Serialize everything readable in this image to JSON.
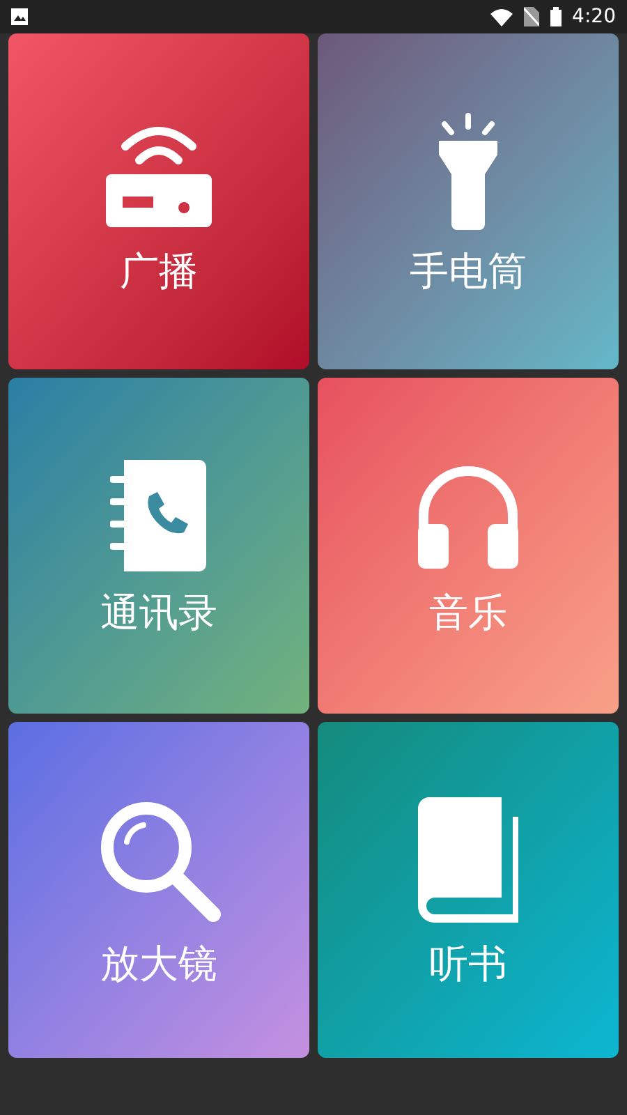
{
  "status_bar": {
    "time": "4:20"
  },
  "tiles": [
    {
      "label": "广播",
      "kind": "radio",
      "color": "#e8445a"
    },
    {
      "label": "手电筒",
      "kind": "flashlight",
      "color": "#6a6a8a"
    },
    {
      "label": "通讯录",
      "kind": "contacts",
      "color": "#3a88a0"
    },
    {
      "label": "音乐",
      "kind": "music",
      "color": "#ee6a70"
    },
    {
      "label": "放大镜",
      "kind": "magnifier",
      "color": "#7478e0"
    },
    {
      "label": "听书",
      "kind": "book",
      "color": "#11988a"
    }
  ]
}
